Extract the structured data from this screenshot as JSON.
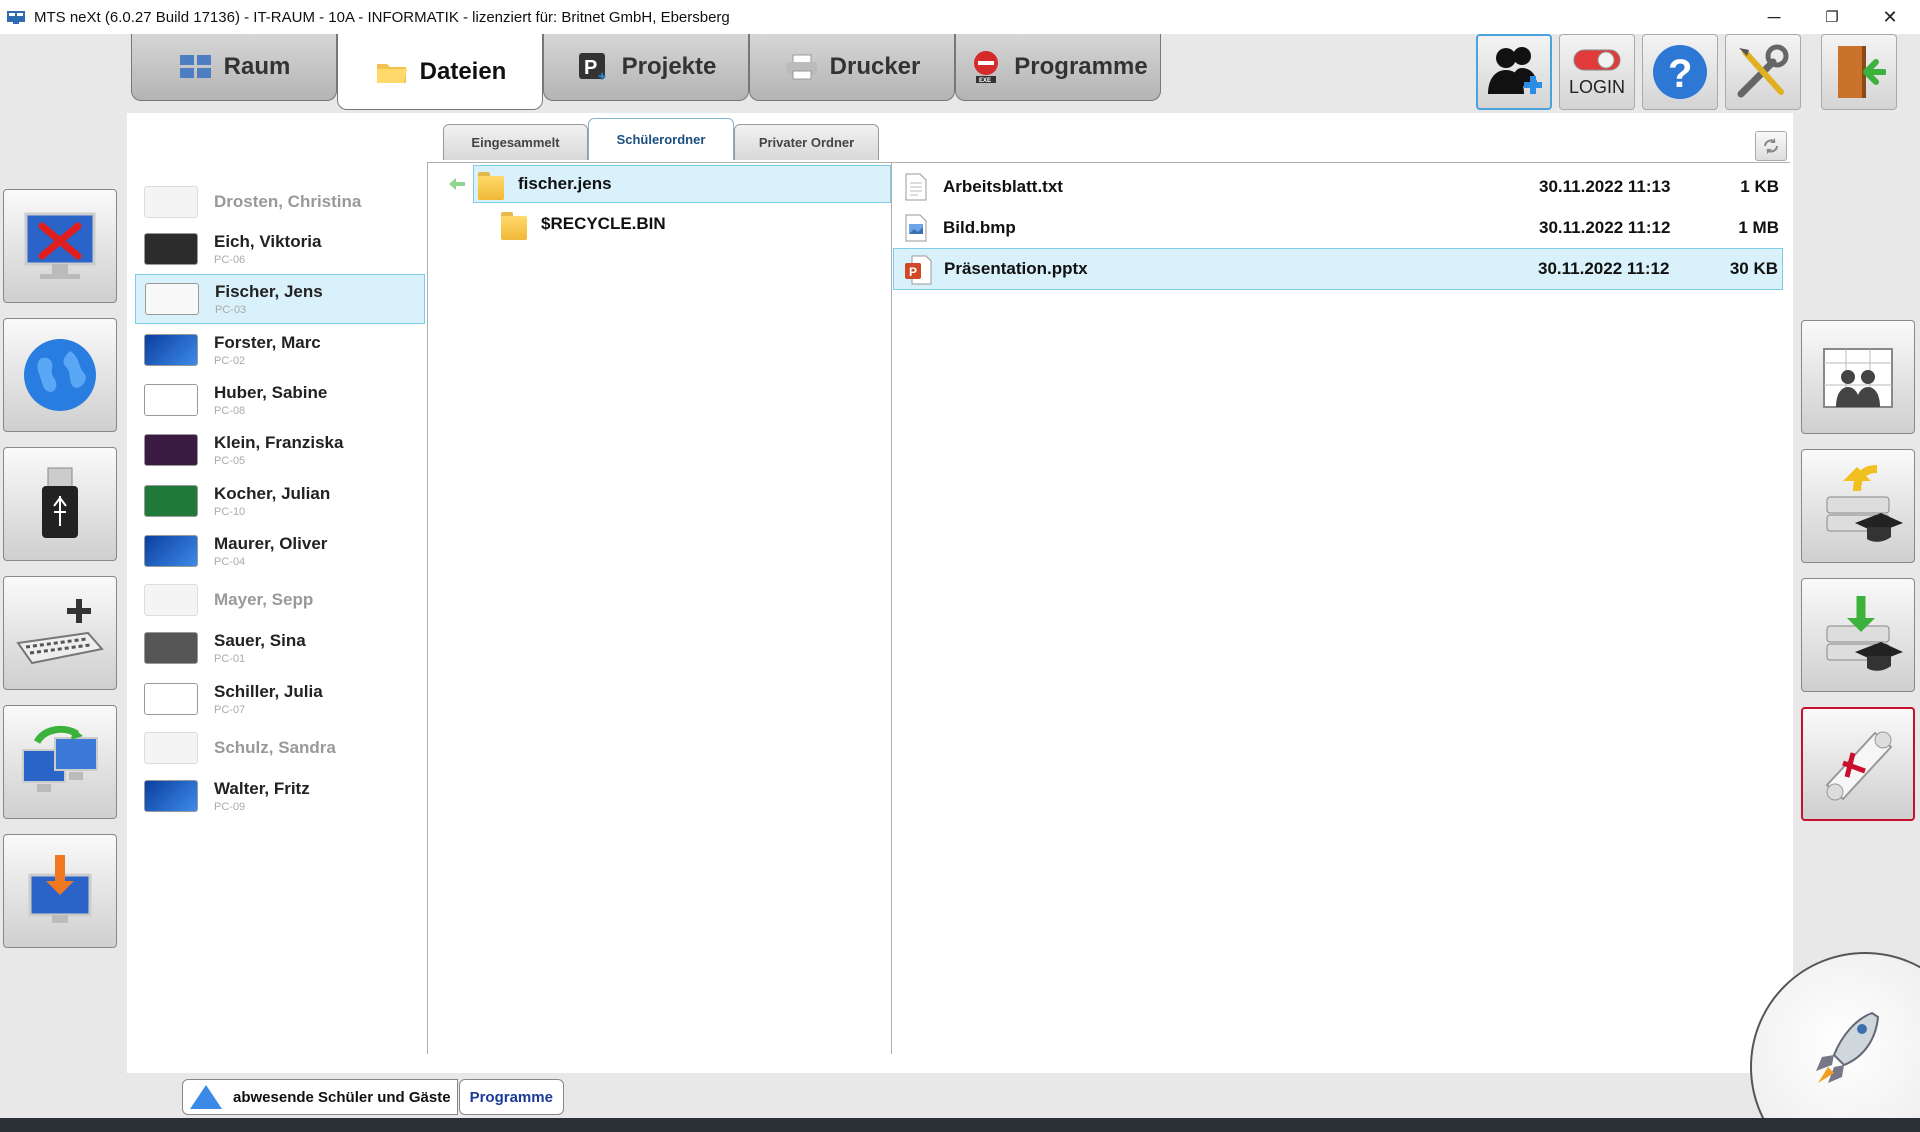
{
  "window": {
    "title": "MTS neXt (6.0.27 Build 17136) - IT-RAUM - 10A - INFORMATIK - lizenziert für: Britnet GmbH, Ebersberg",
    "minimize": "─",
    "restore": "❐",
    "close": "✕"
  },
  "main_tabs": [
    {
      "label": "Raum",
      "icon": "grid-icon"
    },
    {
      "label": "Dateien",
      "icon": "folder-icon",
      "active": true
    },
    {
      "label": "Projekte",
      "icon": "projects-icon"
    },
    {
      "label": "Drucker",
      "icon": "printer-icon"
    },
    {
      "label": "Programme",
      "icon": "stop-programs-icon"
    }
  ],
  "top_buttons": {
    "add_user": "add-user-icon",
    "login_label": "LOGIN",
    "help": "?",
    "settings": "tools-icon",
    "exit": "exit-door-icon"
  },
  "sub_tabs": [
    "Eingesammelt",
    "Schülerordner",
    "Privater Ordner"
  ],
  "students": [
    {
      "name": "Drosten, Christina",
      "pc": "",
      "online": false
    },
    {
      "name": "Eich, Viktoria",
      "pc": "PC-06",
      "online": true
    },
    {
      "name": "Fischer, Jens",
      "pc": "PC-03",
      "online": true,
      "selected": true
    },
    {
      "name": "Forster, Marc",
      "pc": "PC-02",
      "online": true
    },
    {
      "name": "Huber, Sabine",
      "pc": "PC-08",
      "online": true
    },
    {
      "name": "Klein, Franziska",
      "pc": "PC-05",
      "online": true
    },
    {
      "name": "Kocher, Julian",
      "pc": "PC-10",
      "online": true
    },
    {
      "name": "Maurer, Oliver",
      "pc": "PC-04",
      "online": true
    },
    {
      "name": "Mayer, Sepp",
      "pc": "",
      "online": false
    },
    {
      "name": "Sauer, Sina",
      "pc": "PC-01",
      "online": true
    },
    {
      "name": "Schiller, Julia",
      "pc": "PC-07",
      "online": true
    },
    {
      "name": "Schulz, Sandra",
      "pc": "",
      "online": false
    },
    {
      "name": "Walter, Fritz",
      "pc": "PC-09",
      "online": true
    }
  ],
  "folders": {
    "root": "fischer.jens",
    "child": "$RECYCLE.BIN"
  },
  "files": [
    {
      "name": "Arbeitsblatt.txt",
      "date": "30.11.2022 11:13",
      "size": "1 KB",
      "icon": "text-file-icon"
    },
    {
      "name": "Bild.bmp",
      "date": "30.11.2022 11:12",
      "size": "1 MB",
      "icon": "image-file-icon"
    },
    {
      "name": "Präsentation.pptx",
      "date": "30.11.2022 11:12",
      "size": "30 KB",
      "icon": "powerpoint-file-icon",
      "selected": true
    }
  ],
  "left_buttons": [
    "screen-lock-icon",
    "internet-icon",
    "usb-icon",
    "keyboard-add-icon",
    "screen-transfer-icon",
    "screen-download-icon"
  ],
  "right_buttons": [
    "class-room-icon",
    "share-upload-icon",
    "collect-download-icon",
    "exam-certificate-icon"
  ],
  "bottom_bar": {
    "absent_label": "abwesende Schüler und Gäste",
    "programs_label": "Programme"
  },
  "colors": {
    "selection": "#d9f1fb",
    "accent": "#4aa3df",
    "exam_border": "#c8102e"
  }
}
